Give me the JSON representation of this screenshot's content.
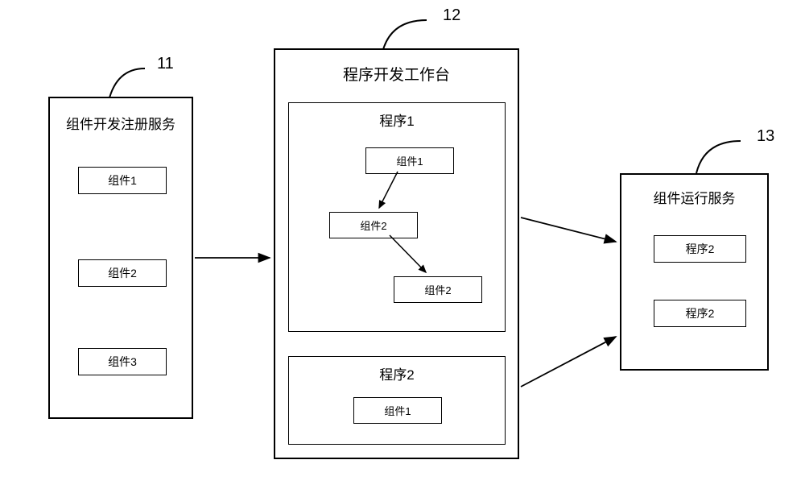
{
  "labels": {
    "n11": "11",
    "n12": "12",
    "n13": "13"
  },
  "registration_service": {
    "title": "组件开发注册服务",
    "items": [
      "组件1",
      "组件2",
      "组件3"
    ]
  },
  "dev_workbench": {
    "title": "程序开发工作台",
    "program1": {
      "title": "程序1",
      "nodes": [
        "组件1",
        "组件2",
        "组件2"
      ]
    },
    "program2": {
      "title": "程序2",
      "nodes": [
        "组件1"
      ]
    }
  },
  "runtime_service": {
    "title": "组件运行服务",
    "items": [
      "程序2",
      "程序2"
    ]
  }
}
